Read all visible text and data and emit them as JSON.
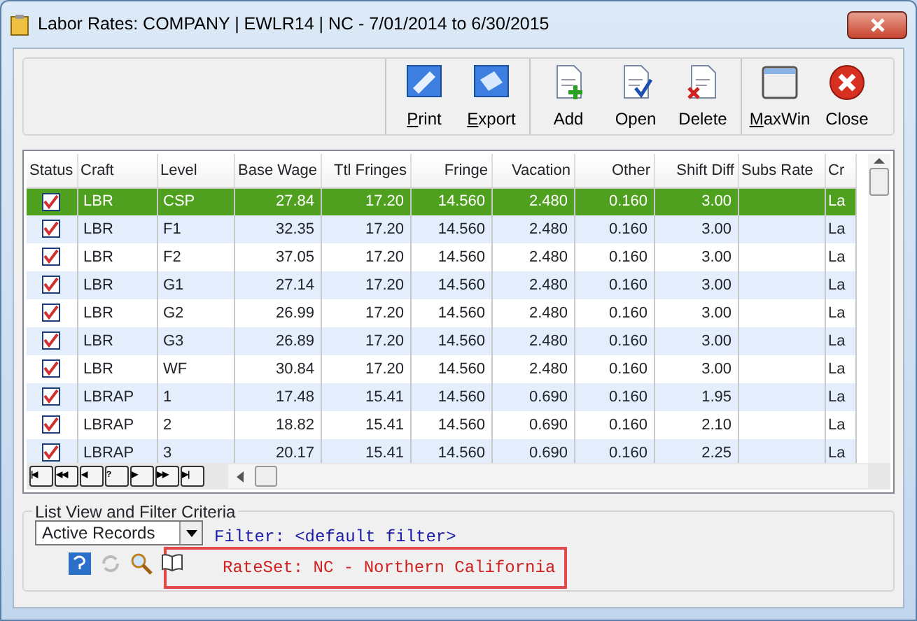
{
  "window": {
    "title": "Labor Rates: COMPANY | EWLR14 | NC -  7/01/2014 to  6/30/2015"
  },
  "toolbar": [
    {
      "label": "Print",
      "kind": "print",
      "mnemonic": true
    },
    {
      "label": "Export",
      "kind": "export",
      "mnemonic": true
    },
    {
      "label": "Add",
      "kind": "add"
    },
    {
      "label": "Open",
      "kind": "open"
    },
    {
      "label": "Delete",
      "kind": "delete"
    },
    {
      "label": "MaxWin",
      "kind": "maxwin",
      "mnemonic": true
    },
    {
      "label": "Close",
      "kind": "close"
    }
  ],
  "table": {
    "status_column": "Status",
    "columns": [
      "Craft",
      "Level",
      "Base Wage",
      "Ttl Fringes",
      "Fringe",
      "Vacation",
      "Other",
      "Shift Diff",
      "Subs Rate",
      "Cr"
    ],
    "rows": [
      {
        "checked": true,
        "selected": true,
        "cells": [
          "LBR",
          "CSP",
          "27.84",
          "17.20",
          "14.560",
          "2.480",
          "0.160",
          "3.00",
          "",
          "La"
        ]
      },
      {
        "checked": true,
        "selected": false,
        "cells": [
          "LBR",
          "F1",
          "32.35",
          "17.20",
          "14.560",
          "2.480",
          "0.160",
          "3.00",
          "",
          "La"
        ]
      },
      {
        "checked": true,
        "selected": false,
        "cells": [
          "LBR",
          "F2",
          "37.05",
          "17.20",
          "14.560",
          "2.480",
          "0.160",
          "3.00",
          "",
          "La"
        ]
      },
      {
        "checked": true,
        "selected": false,
        "cells": [
          "LBR",
          "G1",
          "27.14",
          "17.20",
          "14.560",
          "2.480",
          "0.160",
          "3.00",
          "",
          "La"
        ]
      },
      {
        "checked": true,
        "selected": false,
        "cells": [
          "LBR",
          "G2",
          "26.99",
          "17.20",
          "14.560",
          "2.480",
          "0.160",
          "3.00",
          "",
          "La"
        ]
      },
      {
        "checked": true,
        "selected": false,
        "cells": [
          "LBR",
          "G3",
          "26.89",
          "17.20",
          "14.560",
          "2.480",
          "0.160",
          "3.00",
          "",
          "La"
        ]
      },
      {
        "checked": true,
        "selected": false,
        "cells": [
          "LBR",
          "WF",
          "30.84",
          "17.20",
          "14.560",
          "2.480",
          "0.160",
          "3.00",
          "",
          "La"
        ]
      },
      {
        "checked": true,
        "selected": false,
        "cells": [
          "LBRAP",
          "1",
          "17.48",
          "15.41",
          "14.560",
          "0.690",
          "0.160",
          "1.95",
          "",
          "La"
        ]
      },
      {
        "checked": true,
        "selected": false,
        "cells": [
          "LBRAP",
          "2",
          "18.82",
          "15.41",
          "14.560",
          "0.690",
          "0.160",
          "2.10",
          "",
          "La"
        ]
      },
      {
        "checked": true,
        "selected": false,
        "cells": [
          "LBRAP",
          "3",
          "20.17",
          "15.41",
          "14.560",
          "0.690",
          "0.160",
          "2.25",
          "",
          "La"
        ]
      }
    ]
  },
  "navigator": [
    "|◀",
    "◀◀",
    "◀",
    "?",
    "▶",
    "▶▶",
    "▶|"
  ],
  "filter_panel": {
    "title": "List View and Filter Criteria",
    "view": "Active Records",
    "filter": "Filter: <default filter>",
    "rateset": "RateSet: NC - Northern California"
  }
}
